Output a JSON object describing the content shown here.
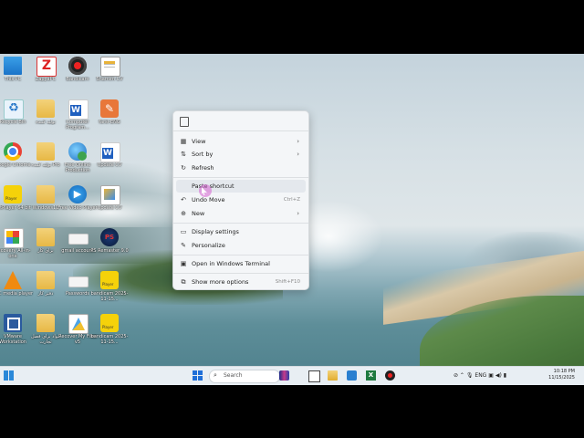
{
  "desktop": {
    "icons": [
      {
        "label": "This PC",
        "icon": "pc"
      },
      {
        "label": "ZapyaPC",
        "icon": "zapya"
      },
      {
        "label": "Bandicam",
        "icon": "rec"
      },
      {
        "label": "Shamim CV",
        "icon": "doc"
      },
      {
        "label": "Recycle Bin",
        "icon": "recycle"
      },
      {
        "label": "تولید کننده",
        "icon": "folder"
      },
      {
        "label": "Computer Program...",
        "icon": "word"
      },
      {
        "label": "farsi-ENG",
        "icon": "orange"
      },
      {
        "label": "Google Chrome",
        "icon": "chrome"
      },
      {
        "label": "تولید کننده Pro",
        "icon": "folder"
      },
      {
        "label": "Free Online Production",
        "icon": "earth"
      },
      {
        "label": "Update CV",
        "icon": "word"
      },
      {
        "label": "PotPlayer 64 bit",
        "icon": "potplayer"
      },
      {
        "label": "Windows11",
        "icon": "folder"
      },
      {
        "label": "Free Video Player",
        "icon": "freevideo"
      },
      {
        "label": "Update CV",
        "icon": "update"
      },
      {
        "label": "Recovery All-in-one",
        "icon": "recovery"
      },
      {
        "label": "برای کار",
        "icon": "folder"
      },
      {
        "label": "gmail account",
        "icon": "white"
      },
      {
        "label": "PS Remaster 9.0",
        "icon": "ps"
      },
      {
        "label": "VLC media player",
        "icon": "vlc"
      },
      {
        "label": "دفتر کار",
        "icon": "folder"
      },
      {
        "label": "Passwords",
        "icon": "white"
      },
      {
        "label": "bandicam 2025-11-15...",
        "icon": "potplayer"
      },
      {
        "label": "VMware Workstation",
        "icon": "vmware"
      },
      {
        "label": "مواد برای فصل تجارت",
        "icon": "folder"
      },
      {
        "label": "Recover My Files v5",
        "icon": "recoverfiles"
      },
      {
        "label": "bandicam 2025-11-15...",
        "icon": "potplayer"
      }
    ]
  },
  "context_menu": {
    "items": [
      {
        "label": "View",
        "icon": "grid-icon",
        "shortcut": "",
        "submenu": true
      },
      {
        "label": "Sort by",
        "icon": "sort-icon",
        "shortcut": "",
        "submenu": true
      },
      {
        "label": "Refresh",
        "icon": "refresh-icon",
        "shortcut": "",
        "submenu": false
      },
      {
        "label": "Paste shortcut",
        "icon": "",
        "shortcut": "",
        "submenu": false
      },
      {
        "label": "Undo Move",
        "icon": "undo-icon",
        "shortcut": "Ctrl+Z",
        "submenu": false
      },
      {
        "label": "New",
        "icon": "plus-icon",
        "shortcut": "",
        "submenu": true
      },
      {
        "label": "Display settings",
        "icon": "display-icon",
        "shortcut": "",
        "submenu": false
      },
      {
        "label": "Personalize",
        "icon": "brush-icon",
        "shortcut": "",
        "submenu": false
      },
      {
        "label": "Open in Windows Terminal",
        "icon": "terminal-icon",
        "shortcut": "",
        "submenu": false
      },
      {
        "label": "Show more options",
        "icon": "more-icon",
        "shortcut": "Shift+F10",
        "submenu": false
      }
    ]
  },
  "taskbar": {
    "search_placeholder": "Search",
    "language": "ENG",
    "time": "10:18 PM",
    "date": "11/15/2025"
  }
}
